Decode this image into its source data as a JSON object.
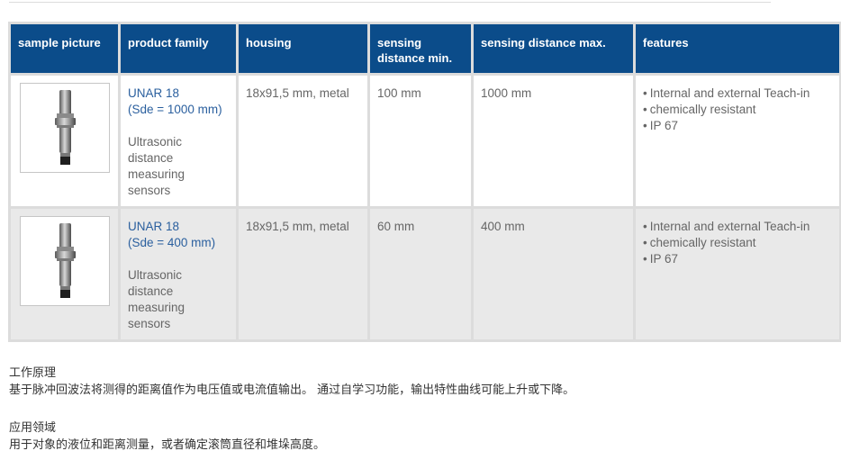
{
  "table": {
    "headers": {
      "sample_picture": "sample picture",
      "product_family": "product family",
      "housing": "housing",
      "sensing_distance_min": "sensing distance min.",
      "sensing_distance_max": "sensing distance max.",
      "features": "features"
    },
    "rows": [
      {
        "product_name": "UNAR 18",
        "product_sde": "(Sde = 1000 mm)",
        "product_desc": "Ultrasonic distance measuring sensors",
        "housing": "18x91,5 mm, metal",
        "sensing_min": "100 mm",
        "sensing_max": "1000 mm",
        "features": [
          "Internal and external Teach-in",
          "chemically resistant",
          "IP 67"
        ]
      },
      {
        "product_name": "UNAR 18",
        "product_sde": "(Sde = 400 mm)",
        "product_desc": "Ultrasonic distance measuring sensors",
        "housing": "18x91,5 mm, metal",
        "sensing_min": "60 mm",
        "sensing_max": "400 mm",
        "features": [
          "Internal and external Teach-in",
          "chemically resistant",
          "IP 67"
        ]
      }
    ]
  },
  "principle": {
    "heading": "工作原理",
    "text": "基于脉冲回波法将测得的距离值作为电压值或电流值输出。 通过自学习功能，输出特性曲线可能上升或下降。"
  },
  "application": {
    "heading": "应用领域",
    "text": "用于对象的液位和距离测量，或者确定滚筒直径和堆垛高度。"
  },
  "icons": {
    "sensor_image": "ultrasonic-sensor-image"
  }
}
